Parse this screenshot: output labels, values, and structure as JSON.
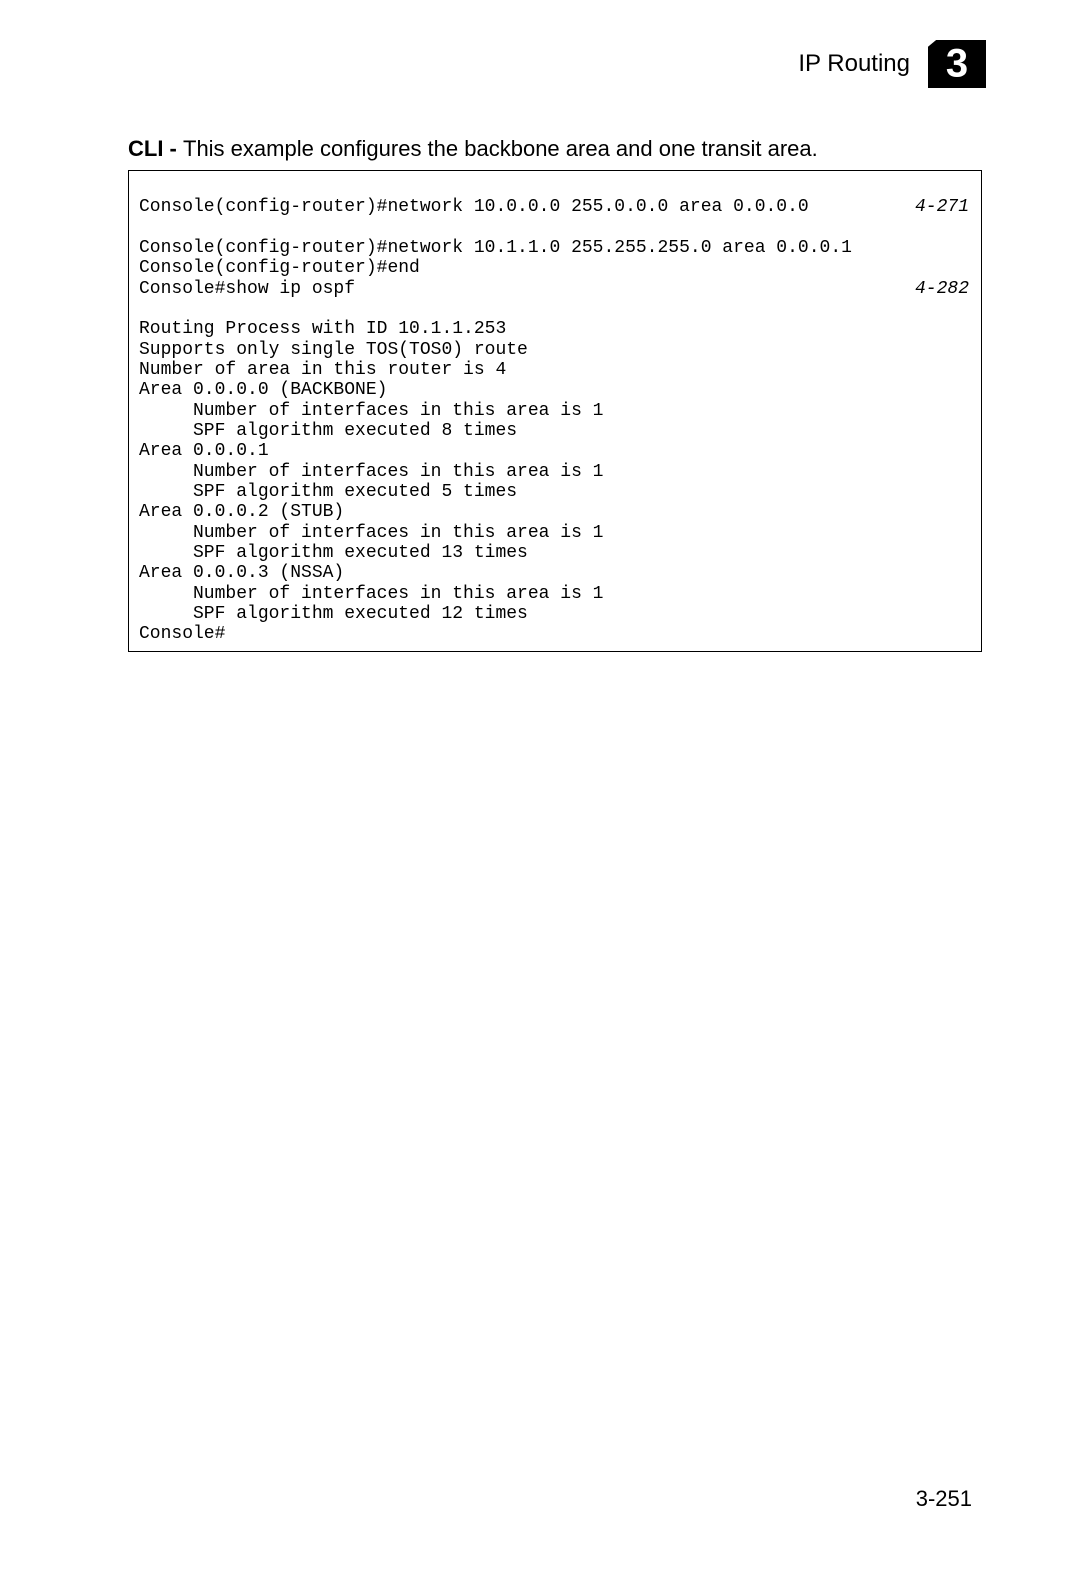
{
  "header": {
    "title": "IP Routing",
    "chapter": "3"
  },
  "intro": {
    "bold": "CLI - ",
    "text": "This example configures the backbone area and one transit area."
  },
  "cli": {
    "line1": {
      "text": "Console(config-router)#network 10.0.0.0 255.0.0.0 area 0.0.0.0",
      "ref": "4-271"
    },
    "line2": "Console(config-router)#network 10.1.1.0 255.255.255.0 area 0.0.0.1",
    "line3": "Console(config-router)#end",
    "line4": {
      "text": "Console#show ip ospf",
      "ref": "4-282"
    },
    "line5": "Routing Process with ID 10.1.1.253",
    "line6": "Supports only single TOS(TOS0) route",
    "line7": "Number of area in this router is 4",
    "line8": "Area 0.0.0.0 (BACKBONE)",
    "line9": "     Number of interfaces in this area is 1",
    "line10": "     SPF algorithm executed 8 times",
    "line11": "Area 0.0.0.1",
    "line12": "     Number of interfaces in this area is 1",
    "line13": "     SPF algorithm executed 5 times",
    "line14": "Area 0.0.0.2 (STUB)",
    "line15": "     Number of interfaces in this area is 1",
    "line16": "     SPF algorithm executed 13 times",
    "line17": "Area 0.0.0.3 (NSSA)",
    "line18": "     Number of interfaces in this area is 1",
    "line19": "     SPF algorithm executed 12 times",
    "line20": "Console#"
  },
  "page_number": "3-251"
}
